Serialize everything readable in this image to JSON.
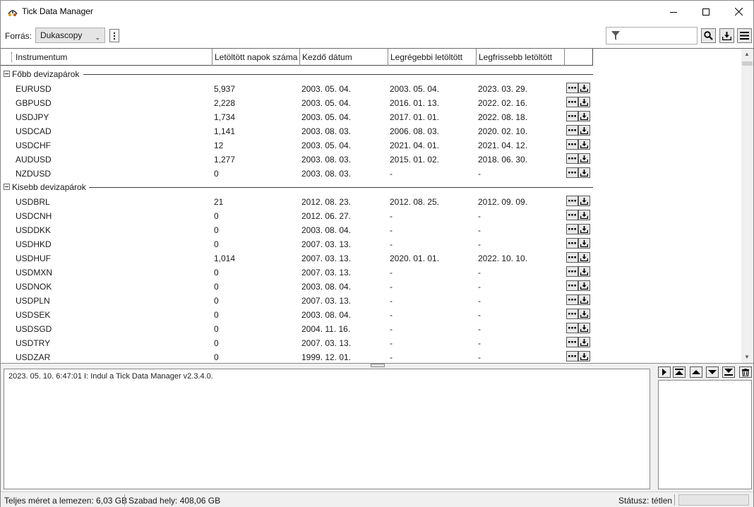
{
  "window": {
    "title": "Tick Data Manager"
  },
  "toolbar": {
    "source_label": "Forrás:",
    "source_value": "Dukascopy",
    "filter_value": "",
    "filter_placeholder": ""
  },
  "grid": {
    "columns": [
      "Instrumentum",
      "Letöltött napok száma",
      "Kezdő dátum",
      "Legrégebbi letöltött",
      "Legfrissebb letöltött"
    ],
    "groups": [
      {
        "name": "Főbb devizapárok",
        "rows": [
          {
            "instrument": "EURUSD",
            "days": "5,937",
            "start": "2003. 05. 04.",
            "oldest": "2003. 05. 04.",
            "newest": "2023. 03. 29."
          },
          {
            "instrument": "GBPUSD",
            "days": "2,228",
            "start": "2003. 05. 04.",
            "oldest": "2016. 01. 13.",
            "newest": "2022. 02. 16."
          },
          {
            "instrument": "USDJPY",
            "days": "1,734",
            "start": "2003. 05. 04.",
            "oldest": "2017. 01. 01.",
            "newest": "2022. 08. 18."
          },
          {
            "instrument": "USDCAD",
            "days": "1,141",
            "start": "2003. 08. 03.",
            "oldest": "2006. 08. 03.",
            "newest": "2020. 02. 10."
          },
          {
            "instrument": "USDCHF",
            "days": "12",
            "start": "2003. 05. 04.",
            "oldest": "2021. 04. 01.",
            "newest": "2021. 04. 12."
          },
          {
            "instrument": "AUDUSD",
            "days": "1,277",
            "start": "2003. 08. 03.",
            "oldest": "2015. 01. 02.",
            "newest": "2018. 06. 30."
          },
          {
            "instrument": "NZDUSD",
            "days": "0",
            "start": "2003. 08. 03.",
            "oldest": "-",
            "newest": "-"
          }
        ]
      },
      {
        "name": "Kisebb devizapárok",
        "rows": [
          {
            "instrument": "USDBRL",
            "days": "21",
            "start": "2012. 08. 23.",
            "oldest": "2012. 08. 25.",
            "newest": "2012. 09. 09."
          },
          {
            "instrument": "USDCNH",
            "days": "0",
            "start": "2012. 06. 27.",
            "oldest": "-",
            "newest": "-"
          },
          {
            "instrument": "USDDKK",
            "days": "0",
            "start": "2003. 08. 04.",
            "oldest": "-",
            "newest": "-"
          },
          {
            "instrument": "USDHKD",
            "days": "0",
            "start": "2007. 03. 13.",
            "oldest": "-",
            "newest": "-"
          },
          {
            "instrument": "USDHUF",
            "days": "1,014",
            "start": "2007. 03. 13.",
            "oldest": "2020. 01. 01.",
            "newest": "2022. 10. 10."
          },
          {
            "instrument": "USDMXN",
            "days": "0",
            "start": "2007. 03. 13.",
            "oldest": "-",
            "newest": "-"
          },
          {
            "instrument": "USDNOK",
            "days": "0",
            "start": "2003. 08. 04.",
            "oldest": "-",
            "newest": "-"
          },
          {
            "instrument": "USDPLN",
            "days": "0",
            "start": "2007. 03. 13.",
            "oldest": "-",
            "newest": "-"
          },
          {
            "instrument": "USDSEK",
            "days": "0",
            "start": "2003. 08. 04.",
            "oldest": "-",
            "newest": "-"
          },
          {
            "instrument": "USDSGD",
            "days": "0",
            "start": "2004. 11. 16.",
            "oldest": "-",
            "newest": "-"
          },
          {
            "instrument": "USDTRY",
            "days": "0",
            "start": "2007. 03. 13.",
            "oldest": "-",
            "newest": "-"
          },
          {
            "instrument": "USDZAR",
            "days": "0",
            "start": "1999. 12. 01.",
            "oldest": "-",
            "newest": "-"
          }
        ]
      }
    ]
  },
  "log": {
    "entries": [
      "2023. 05. 10. 6:47:01  I: Indul a Tick Data Manager v2.3.4.0."
    ]
  },
  "status": {
    "total_size": "Teljes méret a lemezen: 6,03 GB",
    "free_space": "Szabad hely: 408,06 GB",
    "state": "Státusz: tétlen"
  }
}
